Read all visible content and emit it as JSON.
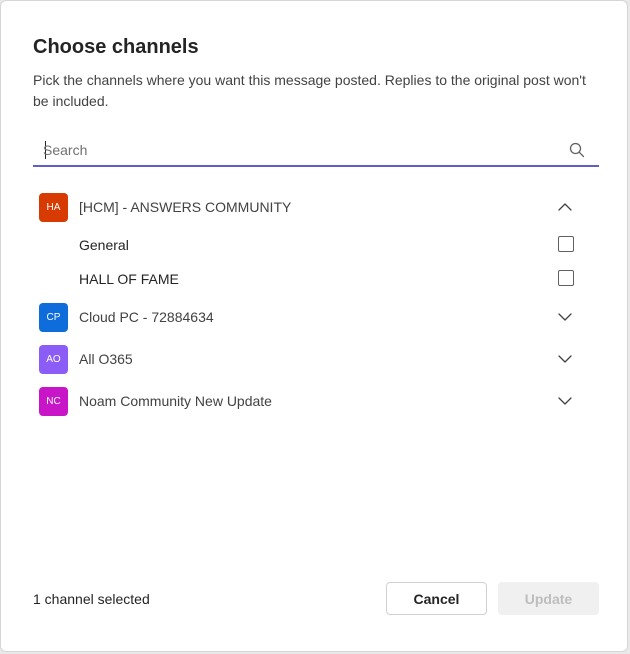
{
  "dialog": {
    "title": "Choose channels",
    "description": "Pick the channels where you want this message posted. Replies to the original post won't be included."
  },
  "search": {
    "placeholder": "Search",
    "value": "",
    "icon": "search-icon"
  },
  "teams": [
    {
      "initials": "HA",
      "name": "[HCM] - ANSWERS COMMUNITY",
      "color": "#d83b01",
      "expanded": true,
      "channels": [
        {
          "name": "General",
          "checked": false
        },
        {
          "name": "HALL OF FAME",
          "checked": false
        }
      ]
    },
    {
      "initials": "CP",
      "name": "Cloud PC - 72884634",
      "color": "#0f6cdb",
      "expanded": false
    },
    {
      "initials": "AO",
      "name": "All O365",
      "color": "#8b5cf6",
      "expanded": false
    },
    {
      "initials": "NC",
      "name": "Noam Community New Update",
      "color": "#c815c8",
      "expanded": false
    }
  ],
  "footer": {
    "status": "1 channel selected",
    "cancel_label": "Cancel",
    "update_label": "Update"
  },
  "colors": {
    "accent": "#5b5fc7",
    "text_primary": "#242424",
    "text_secondary": "#424242",
    "disabled_bg": "#f0f0f0",
    "disabled_text": "#bdbdbd"
  }
}
